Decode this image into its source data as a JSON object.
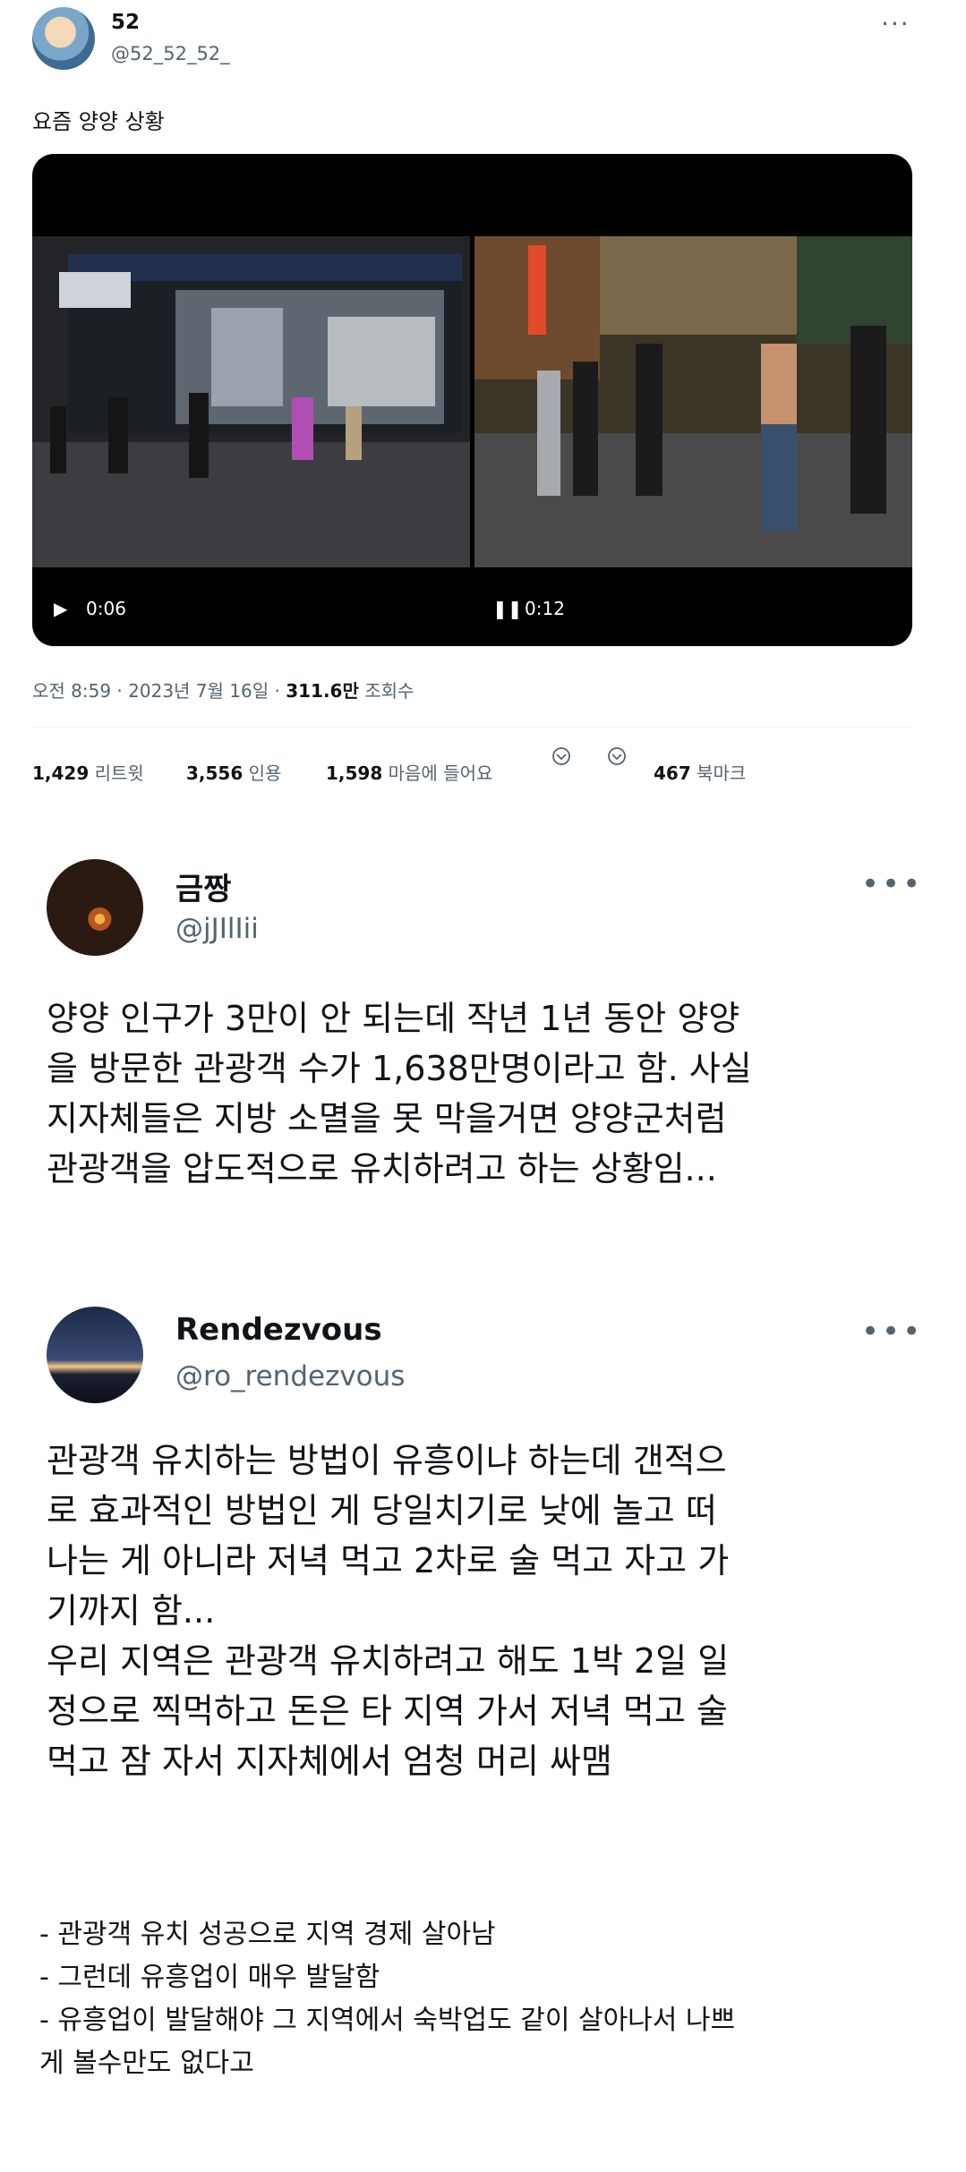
{
  "tweet": {
    "display_name": "52",
    "handle": "@52_52_52_",
    "more_glyph": "···",
    "text": "요즘 양양 상황",
    "videos": [
      {
        "play_glyph": "▶",
        "time": "0:06",
        "state": "playing-paused"
      },
      {
        "play_glyph": "❚❚",
        "time": "0:12",
        "state": "playing"
      }
    ],
    "timestamp": "오전 8:59 · 2023년 7월 16일 · ",
    "views_count": "311.6만",
    "views_label": " 조회수",
    "stats": {
      "retweets_count": "1,429",
      "retweets_label": " 리트윗",
      "quotes_count": "3,556",
      "quotes_label": " 인용",
      "likes_count": "1,598",
      "likes_label": " 마음에 들어요",
      "bookmarks_count": "467",
      "bookmarks_label": " 북마크"
    }
  },
  "reply1": {
    "display_name": "금짱",
    "handle": "@jJIlIii",
    "more_glyph": "•••",
    "lines": [
      "양양 인구가 3만이 안 되는데 작년 1년 동안 양양",
      "을 방문한 관광객 수가 1,638만명이라고 함. 사실",
      "지자체들은 지방 소멸을 못 막을거면 양양군처럼",
      "관광객을 압도적으로 유치하려고 하는 상황임..."
    ]
  },
  "reply2": {
    "display_name": "Rendezvous",
    "handle": "@ro_rendezvous",
    "more_glyph": "•••",
    "lines": [
      "관광객 유치하는 방법이 유흥이냐 하는데 갠적으",
      "로 효과적인 방법인 게 당일치기로 낮에 놀고 떠",
      "나는 게 아니라 저녁 먹고 2차로 술 먹고 자고 가",
      "기까지 함...",
      "우리 지역은 관광객 유치하려고 해도 1박 2일 일",
      "정으로 찍먹하고 돈은 타 지역 가서 저녁 먹고 술",
      "먹고 잠 자서 지자체에서 엄청 머리 싸맴"
    ]
  },
  "comments": [
    "- 관광객 유치 성공으로 지역 경제 살아남",
    "- 그런데 유흥업이 매우 발달함",
    "- 유흥업이 발달해야 그 지역에서 숙박업도 같이 살아나서 나쁘",
    "게 볼수만도 없다고"
  ]
}
